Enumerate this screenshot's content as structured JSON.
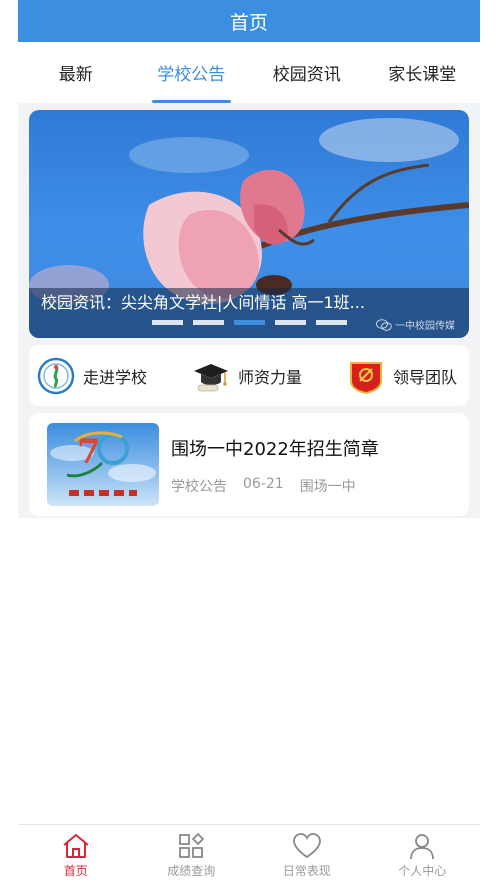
{
  "header": {
    "title": "首页"
  },
  "tabs": [
    {
      "label": "最新",
      "active": false
    },
    {
      "label": "学校公告",
      "active": true
    },
    {
      "label": "校园资讯",
      "active": false
    },
    {
      "label": "家长课堂",
      "active": false
    }
  ],
  "banner": {
    "caption": "校园资讯：尖尖角文学社|人间情话 高一1班...",
    "watermark": "一中校园传媒",
    "dots_total": 5,
    "dot_active_index": 2
  },
  "quick_links": [
    {
      "label": "走进学校",
      "icon": "school-logo-icon"
    },
    {
      "label": "师资力量",
      "icon": "graduation-cap-icon"
    },
    {
      "label": "领导团队",
      "icon": "party-badge-icon"
    }
  ],
  "news": [
    {
      "title": "围场一中2022年招生简章",
      "category": "学校公告",
      "date": "06-21",
      "source": "围场一中"
    }
  ],
  "tabbar": [
    {
      "label": "首页",
      "icon": "home-icon",
      "active": true
    },
    {
      "label": "成绩查询",
      "icon": "grid-icon",
      "active": false
    },
    {
      "label": "日常表现",
      "icon": "heart-icon",
      "active": false
    },
    {
      "label": "个人中心",
      "icon": "person-icon",
      "active": false
    }
  ],
  "colors": {
    "primary": "#3b8ee0",
    "tabbar_active": "#d9263a",
    "background": "#f2f3f5"
  }
}
